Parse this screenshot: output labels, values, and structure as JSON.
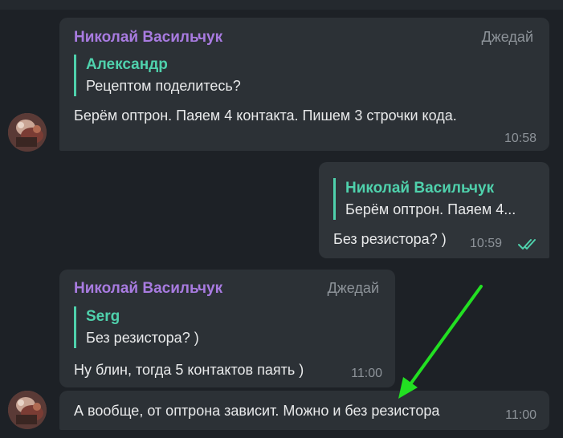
{
  "messages": [
    {
      "sender": "Николай Васильчук",
      "badge": "Джедай",
      "reply_name": "Александр",
      "reply_text": "Рецептом поделитесь?",
      "text": "Берём оптрон. Паяем 4 контакта. Пишем 3 строчки кода.",
      "time": "10:58"
    },
    {
      "reply_name": "Николай Васильчук",
      "reply_text": "Берём оптрон. Паяем 4...",
      "text": "Без резистора? )",
      "time": "10:59"
    },
    {
      "sender": "Николай Васильчук",
      "badge": "Джедай",
      "reply_name": "Serg",
      "reply_text": "Без резистора? )",
      "text": "Ну блин, тогда 5 контактов паять )",
      "time": "11:00"
    },
    {
      "text": "А вообще, от оптрона зависит. Можно и без резистора",
      "time": "11:00"
    }
  ],
  "icons": {
    "read_status": "double-check-icon",
    "annotation": "green-arrow-icon"
  },
  "colors": {
    "background": "#1d2126",
    "bubble": "#2c3136",
    "sender_name": "#a87be0",
    "reply_accent": "#4fd1ac",
    "annotation_arrow": "#22e022"
  }
}
